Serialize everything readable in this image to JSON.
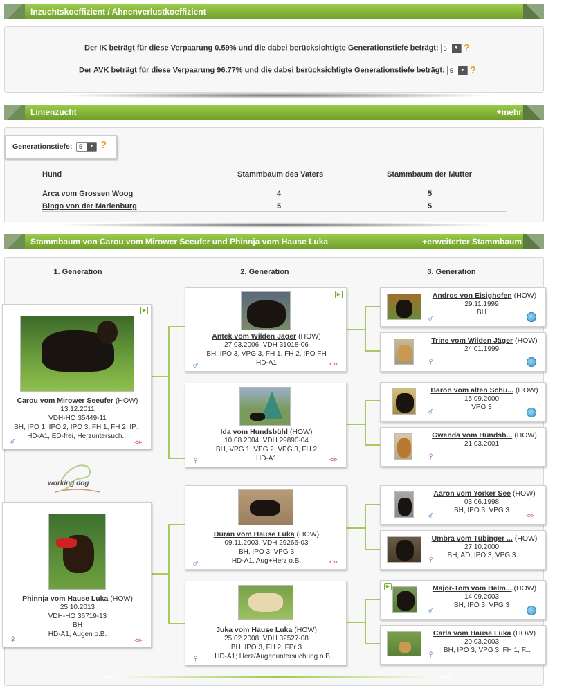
{
  "ik_section": {
    "title": "Inzuchtskoeffizient / Ahnenverlustkoeffizient",
    "ik_text": "Der IK beträgt für diese Verpaarung 0.59% und die dabei berücksichtigte Generationstiefe beträgt:",
    "ik_depth": "5",
    "avk_text": "Der AVK beträgt für diese Verpaarung 96.77% und die dabei berücksichtigte Generationstiefe beträgt:",
    "avk_depth": "5",
    "help": "?"
  },
  "linienzucht": {
    "title": "Linienzucht",
    "more": "+mehr",
    "depth_label": "Generationstiefe:",
    "depth_value": "5",
    "help": "?",
    "columns": [
      "Hund",
      "Stammbaum des Vaters",
      "Stammbaum der Mutter"
    ],
    "rows": [
      {
        "hund": "Arca vom Grossen Woog",
        "vater": "4",
        "mutter": "5"
      },
      {
        "hund": "Bingo von der Marienburg",
        "vater": "5",
        "mutter": "5"
      }
    ]
  },
  "stammbaum": {
    "title": "Stammbaum von Carou vom Mirower Seeufer und Phinnja vom Hause Luka",
    "more": "+erweiterter Stammbaum",
    "gen1": "1. Generation",
    "gen2": "2. Generation",
    "gen3": "3. Generation",
    "logo": "working dog",
    "dogs": {
      "carou": {
        "name": "Carou vom Mirower Seeufer",
        "breed": "(HOW)",
        "l1": "13.12.2011",
        "l2": "VDH-HO 35449-11",
        "l3": "BH, IPO 1, IPO 2, IPO 3, FH 1, FH 2, IP...",
        "l4": "HD-A1, ED-frei, Herzuntersuch..."
      },
      "phinnja": {
        "name": "Phinnja vom Hause Luka",
        "breed": "(HOW)",
        "l1": "25.10.2013",
        "l2": "VDH-HO 36719-13",
        "l3": "BH",
        "l4": "HD-A1, Augen o.B."
      },
      "antek": {
        "name": "Antek vom Wilden Jäger",
        "breed": "(HOW)",
        "l1": "27.03.2006, VDH 31018-06",
        "l2": "BH, IPO 3, VPG 3, FH 1, FH 2, IPO FH",
        "l3": "HD-A1"
      },
      "ida": {
        "name": "Ida vom Hundsbühl",
        "breed": "(HOW)",
        "l1": "10.08.2004, VDH 29890-04",
        "l2": "BH, VPG 1, VPG 2, VPG 3, FH 2",
        "l3": "HD-A1"
      },
      "duran": {
        "name": "Duran vom Hause Luka",
        "breed": "(HOW)",
        "l1": "09.11.2003, VDH 29266-03",
        "l2": "BH, IPO 3, VPG 3",
        "l3": "HD-A1, Aug+Herz o.B."
      },
      "juka": {
        "name": "Juka vom Hause Luka",
        "breed": "(HOW)",
        "l1": "25.02.2008, VDH 32527-08",
        "l2": "BH, IPO 3, FH 2, FPr 3",
        "l3": "HD-A1; Herz/Augenuntersuchung o.B."
      },
      "andros": {
        "name": "Andros von Eisighofen",
        "breed": "(HOW)",
        "l1": "29.11.1999",
        "l2": "BH"
      },
      "trine": {
        "name": "Trine vom Wilden Jäger",
        "breed": "(HOW)",
        "l1": "24.01.1999",
        "l2": ""
      },
      "baron": {
        "name": "Baron vom alten Schu...",
        "breed": "(HOW)",
        "l1": "15.09.2000",
        "l2": "VPG 3"
      },
      "gwenda": {
        "name": "Gwenda vom Hundsb...",
        "breed": "(HOW)",
        "l1": "21.03.2001",
        "l2": ""
      },
      "aaron": {
        "name": "Aaron vom Yorker See",
        "breed": "(HOW)",
        "l1": "03.06.1998",
        "l2": "BH, IPO 3, VPG 3"
      },
      "umbra": {
        "name": "Umbra vom Tübinger ...",
        "breed": "(HOW)",
        "l1": "27.10.2000",
        "l2": "BH, AD, IPO 3, VPG 3"
      },
      "majortom": {
        "name": "Major-Tom vom Helm...",
        "breed": "(HOW)",
        "l1": "14.09.2003",
        "l2": "BH, IPO 3, VPG 3"
      },
      "carla": {
        "name": "Carla vom Hause Luka",
        "breed": "(HOW)",
        "l1": "20.03.2003",
        "l2": "BH, IPO 3, VPG 3, FH 1, F..."
      }
    },
    "male_symbol": "♂",
    "female_symbol": "♀"
  },
  "colors": {
    "accent": "#7fb13a",
    "male": "#3a7cb8",
    "female": "#9a3aa8"
  }
}
